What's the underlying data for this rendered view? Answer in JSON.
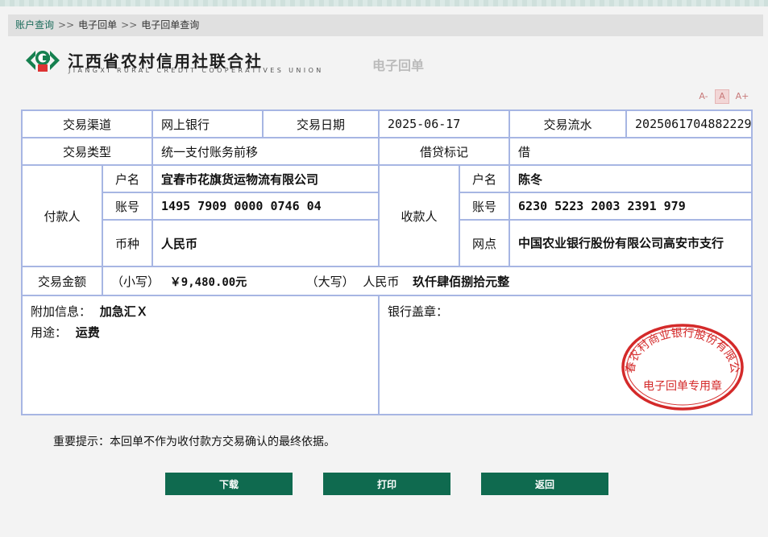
{
  "breadcrumb": {
    "items": [
      "账户查询",
      "电子回单",
      "电子回单查询"
    ],
    "separator": ">>"
  },
  "header": {
    "bank_name_cn": "江西省农村信用社联合社",
    "bank_name_en": "JIANGXI RURAL CREDIT COOPERATIVES UNION",
    "doc_title": "电子回单"
  },
  "font_controls": [
    "A-",
    "A",
    "A+"
  ],
  "receipt": {
    "channel_label": "交易渠道",
    "channel": "网上银行",
    "date_label": "交易日期",
    "date": "2025-06-17",
    "serial_label": "交易流水",
    "serial": "2025061704882229",
    "type_label": "交易类型",
    "type": "统一支付账务前移",
    "dc_label": "借贷标记",
    "dc": "借",
    "payer_label": "付款人",
    "payee_label": "收款人",
    "name_label": "户名",
    "account_label": "账号",
    "currency_label": "币种",
    "branch_label": "网点",
    "payer_name": "宜春市花旗货运物流有限公司",
    "payer_account": "1495 7909 0000 0746 04",
    "payer_currency": "人民币",
    "payee_name": "陈冬",
    "payee_account": "6230 5223 2003 2391 979",
    "payee_branch": "中国农业银行股份有限公司高安市支行",
    "amount_label": "交易金额",
    "amount_small_label": "（小写）",
    "amount_small": "￥9,480.00元",
    "amount_big_label": "（大写）",
    "amount_big_currency": "人民币",
    "amount_big": "玖仟肆佰捌拾元整",
    "extra_label": "附加信息：",
    "extra": "加急汇Ｘ",
    "purpose_label": "用途：",
    "purpose": "运费",
    "stamp_label": "银行盖章：",
    "seal_text_outer": "宜春农村商业银行股份有限公司",
    "seal_text_inner": "电子回单专用章"
  },
  "notice": "重要提示：本回单不作为收付款方交易确认的最终依据。",
  "buttons": {
    "download": "下载",
    "print": "打印",
    "back": "返回"
  },
  "colors": {
    "accent": "#0f6a4f",
    "table_border": "#a7b6e3",
    "seal": "#d42a2a"
  }
}
